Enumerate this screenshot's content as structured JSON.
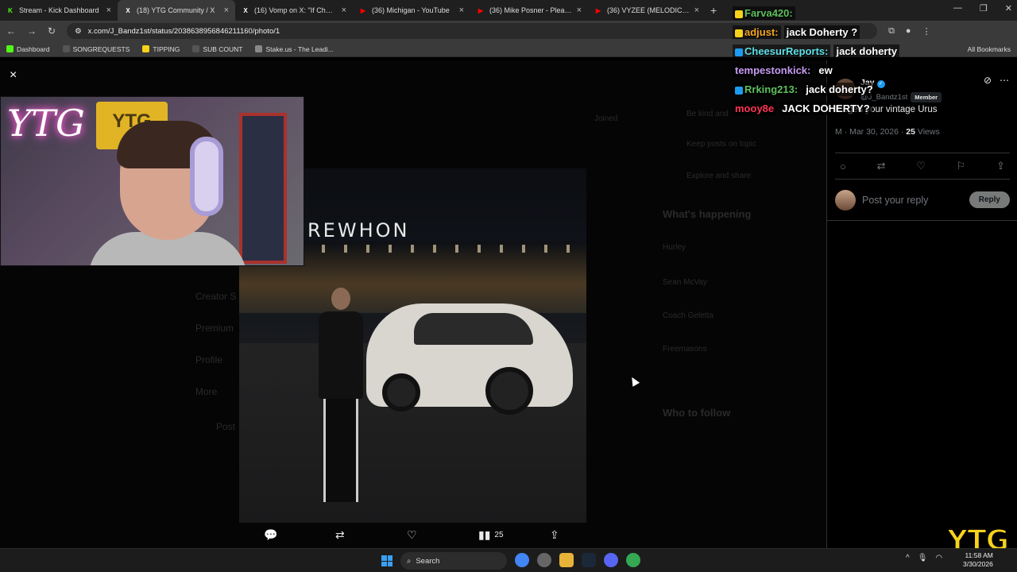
{
  "browser": {
    "tabs": [
      {
        "label": "Stream - Kick Dashboard",
        "icon": "kick-icon",
        "color": "#53fc18",
        "active": false
      },
      {
        "label": "(18) YTG Community / X",
        "icon": "x-icon",
        "color": "#ffffff",
        "active": true
      },
      {
        "label": "(16) Vomp on X: \"If Cheesur lo",
        "icon": "x-icon",
        "color": "#ffffff",
        "active": false
      },
      {
        "label": "(36) Michigan - YouTube",
        "icon": "youtube-icon",
        "color": "#ff0000",
        "active": false
      },
      {
        "label": "(36) Mike Posner - Please Don't",
        "icon": "youtube-icon",
        "color": "#ff0000",
        "active": false
      },
      {
        "label": "(36) VYZEE (MELODIC PART) - Y",
        "icon": "youtube-icon",
        "color": "#ff0000",
        "active": false
      }
    ],
    "new_tab": "+",
    "url": "x.com/J_Bandz1st/status/2038638956846211160/photo/1",
    "bookmarks": [
      {
        "label": "Dashboard",
        "color": "#53fc18"
      },
      {
        "label": "SONGREQUESTS",
        "color": "#555555"
      },
      {
        "label": "TIPPING",
        "color": "#f6d21b"
      },
      {
        "label": "SUB COUNT",
        "color": "#555555"
      },
      {
        "label": "Stake.us - The Leadi...",
        "color": "#888888"
      }
    ],
    "all_bookmarks": "All Bookmarks"
  },
  "viewer": {
    "close": "×",
    "store_sign": "REWHON",
    "ghost_nav": [
      "Creator S",
      "Premium",
      "Profile",
      "More",
      "Post"
    ],
    "ghost_right": [
      "What's happening",
      "Hurley",
      "Sean McVay",
      "Coach Geletta",
      "Freemasons",
      "Who to follow",
      "Joined",
      "Be kind and",
      "Keep posts on topic",
      "Explore and share"
    ],
    "actions": {
      "reply_icon": "comment-icon",
      "repost_icon": "repost-icon",
      "like_icon": "heart-icon",
      "views_icon": "views-icon",
      "views": "25",
      "share_icon": "share-icon"
    }
  },
  "post": {
    "author": "Jay",
    "handle": "@J_Bandz1st",
    "member_badge": "Member",
    "community_tag": "YTG",
    "text": "I ...ged your vintage Urus",
    "time_date": "M · Mar 30, 2026 ·",
    "views": "25",
    "views_label": "Views",
    "reply_placeholder": "Post your reply",
    "reply_button": "Reply"
  },
  "chat": [
    {
      "user": "Farva420:",
      "user_color": "#5ec15e",
      "msg": "",
      "badge": "#f6d21b"
    },
    {
      "user": "adjust:",
      "user_color": "#f6a623",
      "msg": "jack Doherty ?",
      "badge": "#f6d21b"
    },
    {
      "user": "CheesurReports:",
      "user_color": "#5ee0e6",
      "msg": "jack doherty",
      "badge": "#1d9bf0"
    },
    {
      "user": "tempestonkick:",
      "user_color": "#c79bf2",
      "msg": "ew",
      "badge": ""
    },
    {
      "user": "Rrking213:",
      "user_color": "#5ec15e",
      "msg": "jack doherty?",
      "badge": "#1d9bf0"
    },
    {
      "user": "mooy8e",
      "user_color": "#ff3355",
      "msg": "JACK DOHERTY?",
      "badge": ""
    }
  ],
  "overlay_logo": "YTG",
  "webcam_neon": "YTG",
  "webcam_banner": "YTG",
  "taskbar": {
    "search_label": "Search",
    "time": "11:58 AM",
    "date": "3/30/2026"
  }
}
